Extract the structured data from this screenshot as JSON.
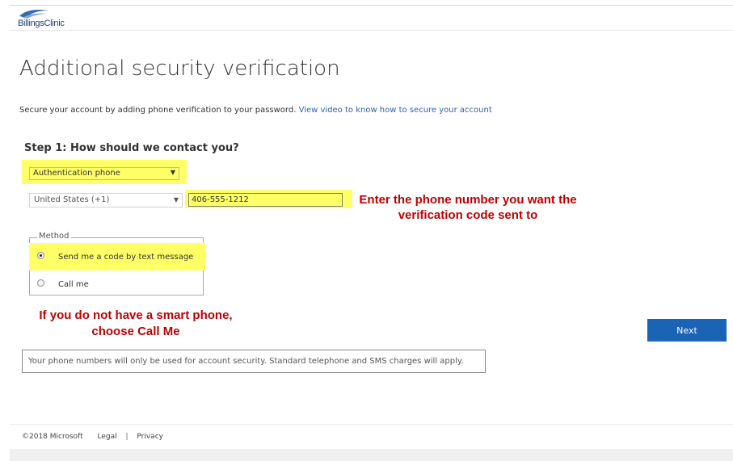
{
  "header": {
    "logo_text": "BillingsClinic"
  },
  "page": {
    "title": "Additional security verification",
    "subtitle": "Secure your account by adding phone verification to your password.",
    "subtitle_link": "View video to know how to secure your account"
  },
  "step1": {
    "heading": "Step 1: How should we contact you?",
    "contact_method_selected": "Authentication phone",
    "country_selected": "United States (+1)",
    "phone_value": "406-555-1212"
  },
  "method": {
    "legend": "Method",
    "options": [
      {
        "label": "Send me a code by text message",
        "selected": true
      },
      {
        "label": "Call me",
        "selected": false
      }
    ]
  },
  "annotations": {
    "phone_callout": "Enter the phone number you want the verification code sent to",
    "callme_callout": "If you do not have a smart phone, choose Call Me"
  },
  "actions": {
    "next_label": "Next"
  },
  "notice": "Your phone numbers will only be used for account security. Standard telephone and SMS charges will apply.",
  "footer": {
    "copyright": "©2018 Microsoft",
    "legal": "Legal",
    "separator": "|",
    "privacy": "Privacy"
  },
  "colors": {
    "highlight": "#ffff66",
    "accent": "#1b63b5",
    "callout": "#c00000",
    "link": "#2b64b6"
  }
}
